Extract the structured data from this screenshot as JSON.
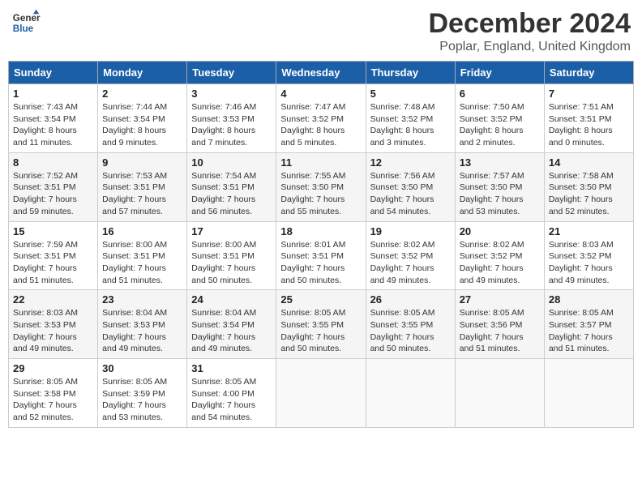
{
  "header": {
    "logo_line1": "General",
    "logo_line2": "Blue",
    "main_title": "December 2024",
    "subtitle": "Poplar, England, United Kingdom"
  },
  "weekdays": [
    "Sunday",
    "Monday",
    "Tuesday",
    "Wednesday",
    "Thursday",
    "Friday",
    "Saturday"
  ],
  "weeks": [
    [
      {
        "day": "1",
        "sunrise": "Sunrise: 7:43 AM",
        "sunset": "Sunset: 3:54 PM",
        "daylight": "Daylight: 8 hours and 11 minutes."
      },
      {
        "day": "2",
        "sunrise": "Sunrise: 7:44 AM",
        "sunset": "Sunset: 3:54 PM",
        "daylight": "Daylight: 8 hours and 9 minutes."
      },
      {
        "day": "3",
        "sunrise": "Sunrise: 7:46 AM",
        "sunset": "Sunset: 3:53 PM",
        "daylight": "Daylight: 8 hours and 7 minutes."
      },
      {
        "day": "4",
        "sunrise": "Sunrise: 7:47 AM",
        "sunset": "Sunset: 3:52 PM",
        "daylight": "Daylight: 8 hours and 5 minutes."
      },
      {
        "day": "5",
        "sunrise": "Sunrise: 7:48 AM",
        "sunset": "Sunset: 3:52 PM",
        "daylight": "Daylight: 8 hours and 3 minutes."
      },
      {
        "day": "6",
        "sunrise": "Sunrise: 7:50 AM",
        "sunset": "Sunset: 3:52 PM",
        "daylight": "Daylight: 8 hours and 2 minutes."
      },
      {
        "day": "7",
        "sunrise": "Sunrise: 7:51 AM",
        "sunset": "Sunset: 3:51 PM",
        "daylight": "Daylight: 8 hours and 0 minutes."
      }
    ],
    [
      {
        "day": "8",
        "sunrise": "Sunrise: 7:52 AM",
        "sunset": "Sunset: 3:51 PM",
        "daylight": "Daylight: 7 hours and 59 minutes."
      },
      {
        "day": "9",
        "sunrise": "Sunrise: 7:53 AM",
        "sunset": "Sunset: 3:51 PM",
        "daylight": "Daylight: 7 hours and 57 minutes."
      },
      {
        "day": "10",
        "sunrise": "Sunrise: 7:54 AM",
        "sunset": "Sunset: 3:51 PM",
        "daylight": "Daylight: 7 hours and 56 minutes."
      },
      {
        "day": "11",
        "sunrise": "Sunrise: 7:55 AM",
        "sunset": "Sunset: 3:50 PM",
        "daylight": "Daylight: 7 hours and 55 minutes."
      },
      {
        "day": "12",
        "sunrise": "Sunrise: 7:56 AM",
        "sunset": "Sunset: 3:50 PM",
        "daylight": "Daylight: 7 hours and 54 minutes."
      },
      {
        "day": "13",
        "sunrise": "Sunrise: 7:57 AM",
        "sunset": "Sunset: 3:50 PM",
        "daylight": "Daylight: 7 hours and 53 minutes."
      },
      {
        "day": "14",
        "sunrise": "Sunrise: 7:58 AM",
        "sunset": "Sunset: 3:50 PM",
        "daylight": "Daylight: 7 hours and 52 minutes."
      }
    ],
    [
      {
        "day": "15",
        "sunrise": "Sunrise: 7:59 AM",
        "sunset": "Sunset: 3:51 PM",
        "daylight": "Daylight: 7 hours and 51 minutes."
      },
      {
        "day": "16",
        "sunrise": "Sunrise: 8:00 AM",
        "sunset": "Sunset: 3:51 PM",
        "daylight": "Daylight: 7 hours and 51 minutes."
      },
      {
        "day": "17",
        "sunrise": "Sunrise: 8:00 AM",
        "sunset": "Sunset: 3:51 PM",
        "daylight": "Daylight: 7 hours and 50 minutes."
      },
      {
        "day": "18",
        "sunrise": "Sunrise: 8:01 AM",
        "sunset": "Sunset: 3:51 PM",
        "daylight": "Daylight: 7 hours and 50 minutes."
      },
      {
        "day": "19",
        "sunrise": "Sunrise: 8:02 AM",
        "sunset": "Sunset: 3:52 PM",
        "daylight": "Daylight: 7 hours and 49 minutes."
      },
      {
        "day": "20",
        "sunrise": "Sunrise: 8:02 AM",
        "sunset": "Sunset: 3:52 PM",
        "daylight": "Daylight: 7 hours and 49 minutes."
      },
      {
        "day": "21",
        "sunrise": "Sunrise: 8:03 AM",
        "sunset": "Sunset: 3:52 PM",
        "daylight": "Daylight: 7 hours and 49 minutes."
      }
    ],
    [
      {
        "day": "22",
        "sunrise": "Sunrise: 8:03 AM",
        "sunset": "Sunset: 3:53 PM",
        "daylight": "Daylight: 7 hours and 49 minutes."
      },
      {
        "day": "23",
        "sunrise": "Sunrise: 8:04 AM",
        "sunset": "Sunset: 3:53 PM",
        "daylight": "Daylight: 7 hours and 49 minutes."
      },
      {
        "day": "24",
        "sunrise": "Sunrise: 8:04 AM",
        "sunset": "Sunset: 3:54 PM",
        "daylight": "Daylight: 7 hours and 49 minutes."
      },
      {
        "day": "25",
        "sunrise": "Sunrise: 8:05 AM",
        "sunset": "Sunset: 3:55 PM",
        "daylight": "Daylight: 7 hours and 50 minutes."
      },
      {
        "day": "26",
        "sunrise": "Sunrise: 8:05 AM",
        "sunset": "Sunset: 3:55 PM",
        "daylight": "Daylight: 7 hours and 50 minutes."
      },
      {
        "day": "27",
        "sunrise": "Sunrise: 8:05 AM",
        "sunset": "Sunset: 3:56 PM",
        "daylight": "Daylight: 7 hours and 51 minutes."
      },
      {
        "day": "28",
        "sunrise": "Sunrise: 8:05 AM",
        "sunset": "Sunset: 3:57 PM",
        "daylight": "Daylight: 7 hours and 51 minutes."
      }
    ],
    [
      {
        "day": "29",
        "sunrise": "Sunrise: 8:05 AM",
        "sunset": "Sunset: 3:58 PM",
        "daylight": "Daylight: 7 hours and 52 minutes."
      },
      {
        "day": "30",
        "sunrise": "Sunrise: 8:05 AM",
        "sunset": "Sunset: 3:59 PM",
        "daylight": "Daylight: 7 hours and 53 minutes."
      },
      {
        "day": "31",
        "sunrise": "Sunrise: 8:05 AM",
        "sunset": "Sunset: 4:00 PM",
        "daylight": "Daylight: 7 hours and 54 minutes."
      },
      null,
      null,
      null,
      null
    ]
  ]
}
